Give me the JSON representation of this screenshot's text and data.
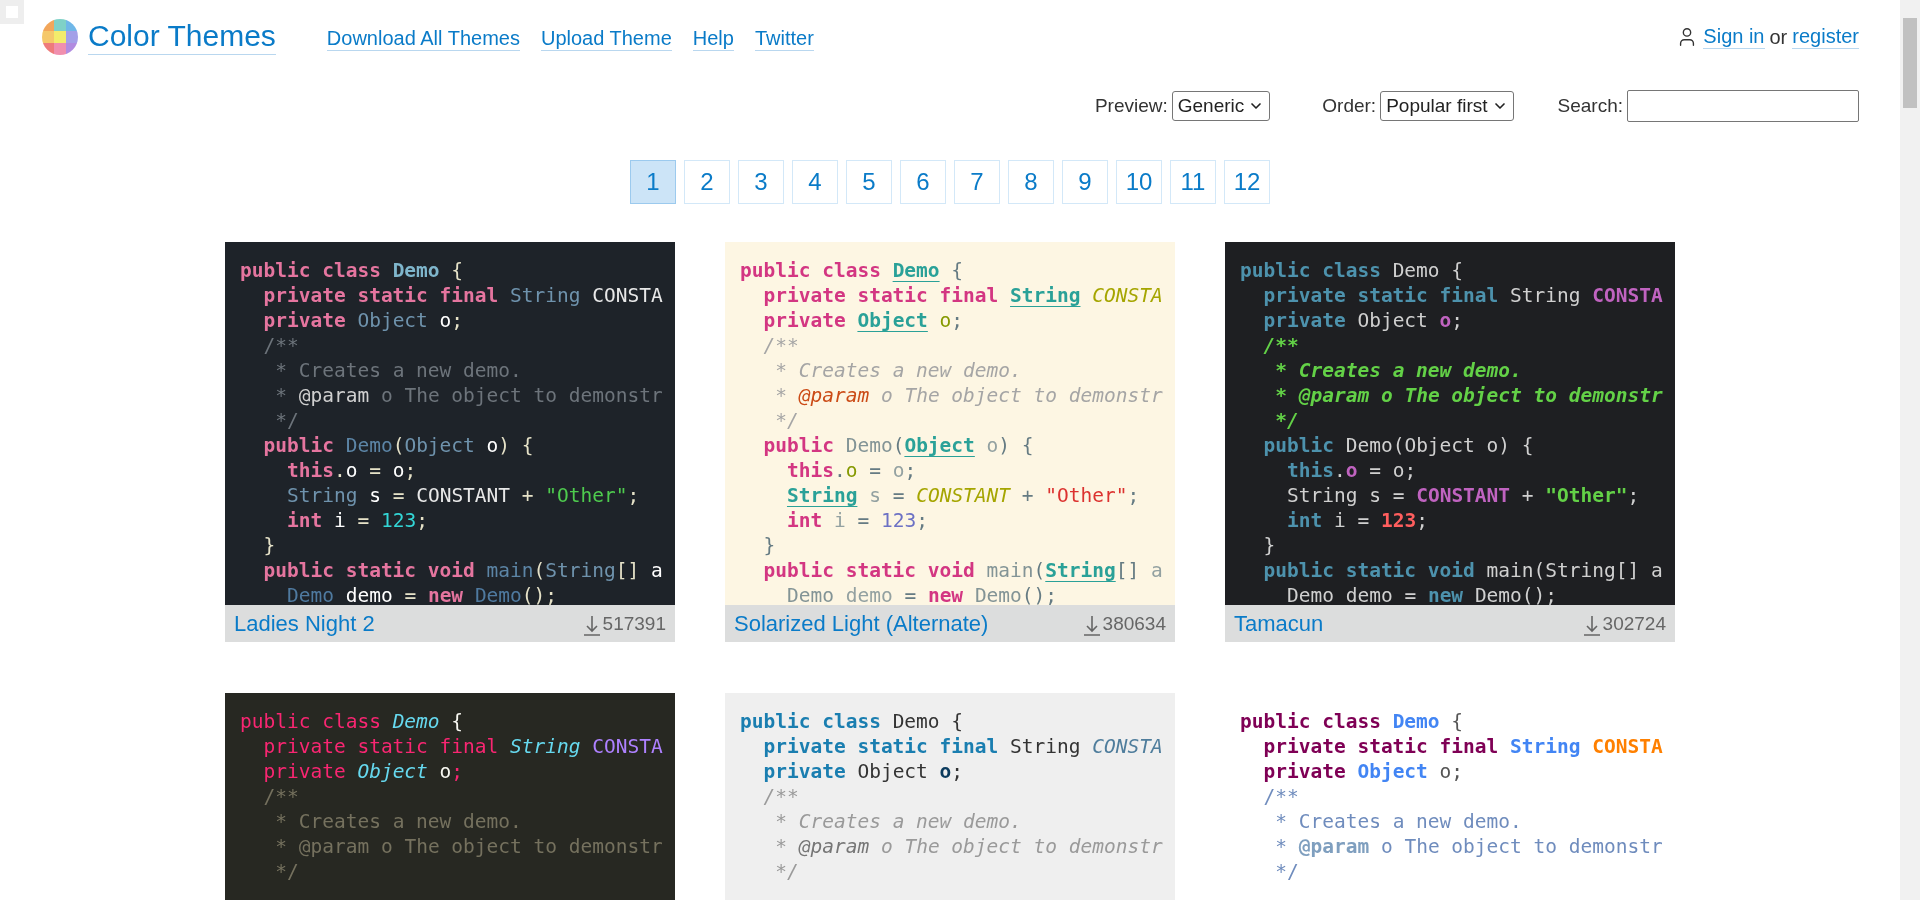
{
  "site": {
    "title": "Color Themes"
  },
  "nav": [
    "Download All Themes",
    "Upload Theme",
    "Help",
    "Twitter"
  ],
  "account": {
    "sign_in": "Sign in",
    "or": "or",
    "register": "register"
  },
  "controls": {
    "preview_label": "Preview:",
    "preview_value": "Generic",
    "order_label": "Order:",
    "order_value": "Popular first",
    "search_label": "Search:"
  },
  "pages": [
    {
      "label": "1",
      "selected": true
    },
    {
      "label": "2",
      "selected": false
    },
    {
      "label": "3",
      "selected": false
    },
    {
      "label": "4",
      "selected": false
    },
    {
      "label": "5",
      "selected": false
    },
    {
      "label": "6",
      "selected": false
    },
    {
      "label": "7",
      "selected": false
    },
    {
      "label": "8",
      "selected": false
    },
    {
      "label": "9",
      "selected": false
    },
    {
      "label": "10",
      "selected": false
    },
    {
      "label": "11",
      "selected": false
    },
    {
      "label": "12",
      "selected": false
    }
  ],
  "themes": [
    {
      "name": "Ladies Night 2",
      "downloads": "517391",
      "lines": [
        {
          "tokens": [
            {
              "kind": "kw",
              "text": "public class "
            },
            {
              "kind": "cls",
              "text": "Demo"
            },
            {
              "kind": "plain",
              "text": " {"
            }
          ]
        },
        {
          "tokens": [
            {
              "kind": "kw",
              "text": "  private static final "
            },
            {
              "kind": "type",
              "text": "String"
            },
            {
              "kind": "const",
              "text": " CONSTA"
            }
          ]
        },
        {
          "tokens": [
            {
              "kind": "kw",
              "text": "  private "
            },
            {
              "kind": "type",
              "text": "Object"
            },
            {
              "kind": "field",
              "text": " o"
            },
            {
              "kind": "plain",
              "text": ";"
            }
          ]
        },
        {
          "tokens": [
            {
              "kind": "comment",
              "text": "  /**"
            }
          ]
        },
        {
          "tokens": [
            {
              "kind": "comment",
              "text": "   * Creates a new demo."
            }
          ]
        },
        {
          "tokens": [
            {
              "kind": "comment",
              "text": "   * "
            },
            {
              "kind": "doctag",
              "text": "@param"
            },
            {
              "kind": "comment",
              "text": " o The object to demonstr"
            }
          ]
        },
        {
          "tokens": [
            {
              "kind": "comment",
              "text": "   */"
            }
          ]
        },
        {
          "tokens": [
            {
              "kind": "kw",
              "text": "  public "
            },
            {
              "kind": "fn",
              "text": "Demo"
            },
            {
              "kind": "plain",
              "text": "("
            },
            {
              "kind": "type",
              "text": "Object"
            },
            {
              "kind": "var",
              "text": " o"
            },
            {
              "kind": "plain",
              "text": ") {"
            }
          ]
        },
        {
          "tokens": [
            {
              "kind": "kw",
              "text": "    this"
            },
            {
              "kind": "plain",
              "text": "."
            },
            {
              "kind": "field",
              "text": "o"
            },
            {
              "kind": "plain",
              "text": " = "
            },
            {
              "kind": "var",
              "text": "o"
            },
            {
              "kind": "plain",
              "text": ";"
            }
          ]
        },
        {
          "tokens": [
            {
              "kind": "type",
              "text": "    String"
            },
            {
              "kind": "var",
              "text": " s"
            },
            {
              "kind": "plain",
              "text": " = "
            },
            {
              "kind": "const",
              "text": "CONSTANT"
            },
            {
              "kind": "plain",
              "text": " + "
            },
            {
              "kind": "str",
              "text": "\"Other\""
            },
            {
              "kind": "plain",
              "text": ";"
            }
          ]
        },
        {
          "tokens": [
            {
              "kind": "kw",
              "text": "    int"
            },
            {
              "kind": "var",
              "text": " i"
            },
            {
              "kind": "plain",
              "text": " = "
            },
            {
              "kind": "num",
              "text": "123"
            },
            {
              "kind": "plain",
              "text": ";"
            }
          ]
        },
        {
          "tokens": [
            {
              "kind": "plain",
              "text": "  }"
            }
          ]
        },
        {
          "tokens": [
            {
              "kind": "kw",
              "text": "  public static void "
            },
            {
              "kind": "fn",
              "text": "main"
            },
            {
              "kind": "plain",
              "text": "("
            },
            {
              "kind": "type",
              "text": "String"
            },
            {
              "kind": "plain",
              "text": "[] "
            },
            {
              "kind": "var",
              "text": "a"
            }
          ]
        },
        {
          "tokens": [
            {
              "kind": "ref",
              "text": "    Demo"
            },
            {
              "kind": "var",
              "text": " demo"
            },
            {
              "kind": "plain",
              "text": " = "
            },
            {
              "kind": "kw",
              "text": "new"
            },
            {
              "kind": "ref",
              "text": " Demo"
            },
            {
              "kind": "plain",
              "text": "();"
            }
          ]
        }
      ]
    },
    {
      "name": "Solarized Light (Alternate)",
      "downloads": "380634",
      "lines": [
        {
          "tokens": [
            {
              "kind": "kw",
              "text": "public class "
            },
            {
              "kind": "cls",
              "text": "Demo"
            },
            {
              "kind": "plain",
              "text": " {"
            }
          ]
        },
        {
          "tokens": [
            {
              "kind": "kw",
              "text": "  private static final "
            },
            {
              "kind": "type",
              "text": "String"
            },
            {
              "kind": "const",
              "text": " CONSTA"
            }
          ]
        },
        {
          "tokens": [
            {
              "kind": "kw",
              "text": "  private "
            },
            {
              "kind": "type",
              "text": "Object"
            },
            {
              "kind": "field",
              "text": " o"
            },
            {
              "kind": "plain",
              "text": ";"
            }
          ]
        },
        {
          "tokens": [
            {
              "kind": "comment",
              "text": "  /**"
            }
          ]
        },
        {
          "tokens": [
            {
              "kind": "comment",
              "text": "   * Creates a new demo."
            }
          ]
        },
        {
          "tokens": [
            {
              "kind": "comment",
              "text": "   * "
            },
            {
              "kind": "doctag",
              "text": "@param"
            },
            {
              "kind": "comment",
              "text": " o The object to demonstr"
            }
          ]
        },
        {
          "tokens": [
            {
              "kind": "comment",
              "text": "   */"
            }
          ]
        },
        {
          "tokens": [
            {
              "kind": "kw",
              "text": "  public "
            },
            {
              "kind": "fn",
              "text": "Demo"
            },
            {
              "kind": "plain",
              "text": "("
            },
            {
              "kind": "type",
              "text": "Object"
            },
            {
              "kind": "var",
              "text": " o"
            },
            {
              "kind": "plain",
              "text": ") {"
            }
          ]
        },
        {
          "tokens": [
            {
              "kind": "kw",
              "text": "    this"
            },
            {
              "kind": "plain",
              "text": "."
            },
            {
              "kind": "field",
              "text": "o"
            },
            {
              "kind": "plain",
              "text": " = "
            },
            {
              "kind": "var",
              "text": "o"
            },
            {
              "kind": "plain",
              "text": ";"
            }
          ]
        },
        {
          "tokens": [
            {
              "kind": "type",
              "text": "    String"
            },
            {
              "kind": "var",
              "text": " s"
            },
            {
              "kind": "plain",
              "text": " = "
            },
            {
              "kind": "const",
              "text": "CONSTANT"
            },
            {
              "kind": "plain",
              "text": " + "
            },
            {
              "kind": "str",
              "text": "\"Other\""
            },
            {
              "kind": "plain",
              "text": ";"
            }
          ]
        },
        {
          "tokens": [
            {
              "kind": "kw",
              "text": "    int"
            },
            {
              "kind": "var",
              "text": " i"
            },
            {
              "kind": "plain",
              "text": " = "
            },
            {
              "kind": "num",
              "text": "123"
            },
            {
              "kind": "plain",
              "text": ";"
            }
          ]
        },
        {
          "tokens": [
            {
              "kind": "plain",
              "text": "  }"
            }
          ]
        },
        {
          "tokens": [
            {
              "kind": "kw",
              "text": "  public static void "
            },
            {
              "kind": "fn",
              "text": "main"
            },
            {
              "kind": "plain",
              "text": "("
            },
            {
              "kind": "type",
              "text": "String"
            },
            {
              "kind": "plain",
              "text": "[] "
            },
            {
              "kind": "var",
              "text": "a"
            }
          ]
        },
        {
          "tokens": [
            {
              "kind": "ref",
              "text": "    Demo"
            },
            {
              "kind": "var",
              "text": " demo"
            },
            {
              "kind": "plain",
              "text": " = "
            },
            {
              "kind": "kw",
              "text": "new"
            },
            {
              "kind": "ref",
              "text": " Demo"
            },
            {
              "kind": "plain",
              "text": "();"
            }
          ]
        }
      ]
    },
    {
      "name": "Tamacun",
      "downloads": "302724",
      "lines": [
        {
          "tokens": [
            {
              "kind": "kw",
              "text": "public class "
            },
            {
              "kind": "cls",
              "text": "Demo"
            },
            {
              "kind": "plain",
              "text": " {"
            }
          ]
        },
        {
          "tokens": [
            {
              "kind": "kw",
              "text": "  private static final "
            },
            {
              "kind": "type",
              "text": "String"
            },
            {
              "kind": "const",
              "text": " CONSTA"
            }
          ]
        },
        {
          "tokens": [
            {
              "kind": "kw",
              "text": "  private "
            },
            {
              "kind": "type",
              "text": "Object"
            },
            {
              "kind": "field",
              "text": " o"
            },
            {
              "kind": "plain",
              "text": ";"
            }
          ]
        },
        {
          "tokens": [
            {
              "kind": "comment",
              "text": "  /**"
            }
          ]
        },
        {
          "tokens": [
            {
              "kind": "comment",
              "text": "   * Creates a new demo."
            }
          ]
        },
        {
          "tokens": [
            {
              "kind": "comment",
              "text": "   * "
            },
            {
              "kind": "doctag",
              "text": "@param"
            },
            {
              "kind": "comment",
              "text": " o The object to demonstr"
            }
          ]
        },
        {
          "tokens": [
            {
              "kind": "comment",
              "text": "   */"
            }
          ]
        },
        {
          "tokens": [
            {
              "kind": "kw",
              "text": "  public "
            },
            {
              "kind": "fn",
              "text": "Demo"
            },
            {
              "kind": "plain",
              "text": "("
            },
            {
              "kind": "type",
              "text": "Object"
            },
            {
              "kind": "var",
              "text": " o"
            },
            {
              "kind": "plain",
              "text": ") {"
            }
          ]
        },
        {
          "tokens": [
            {
              "kind": "kw",
              "text": "    this"
            },
            {
              "kind": "plain",
              "text": "."
            },
            {
              "kind": "field",
              "text": "o"
            },
            {
              "kind": "plain",
              "text": " = "
            },
            {
              "kind": "var",
              "text": "o"
            },
            {
              "kind": "plain",
              "text": ";"
            }
          ]
        },
        {
          "tokens": [
            {
              "kind": "type",
              "text": "    String"
            },
            {
              "kind": "var",
              "text": " s"
            },
            {
              "kind": "plain",
              "text": " = "
            },
            {
              "kind": "const",
              "text": "CONSTANT"
            },
            {
              "kind": "plain",
              "text": " + "
            },
            {
              "kind": "str",
              "text": "\"Other\""
            },
            {
              "kind": "plain",
              "text": ";"
            }
          ]
        },
        {
          "tokens": [
            {
              "kind": "kw",
              "text": "    int"
            },
            {
              "kind": "var",
              "text": " i"
            },
            {
              "kind": "plain",
              "text": " = "
            },
            {
              "kind": "num",
              "text": "123"
            },
            {
              "kind": "plain",
              "text": ";"
            }
          ]
        },
        {
          "tokens": [
            {
              "kind": "plain",
              "text": "  }"
            }
          ]
        },
        {
          "tokens": [
            {
              "kind": "kw",
              "text": "  public static void "
            },
            {
              "kind": "fn",
              "text": "main"
            },
            {
              "kind": "plain",
              "text": "("
            },
            {
              "kind": "type",
              "text": "String"
            },
            {
              "kind": "plain",
              "text": "[] "
            },
            {
              "kind": "var",
              "text": "a"
            }
          ]
        },
        {
          "tokens": [
            {
              "kind": "ref",
              "text": "    Demo"
            },
            {
              "kind": "var",
              "text": " demo"
            },
            {
              "kind": "plain",
              "text": " = "
            },
            {
              "kind": "kw",
              "text": "new"
            },
            {
              "kind": "ref",
              "text": " Demo"
            },
            {
              "kind": "plain",
              "text": "();"
            }
          ]
        }
      ]
    },
    {
      "lines": [
        {
          "tokens": [
            {
              "kind": "kw",
              "text": "public class "
            },
            {
              "kind": "cls",
              "text": "Demo"
            },
            {
              "kind": "plain",
              "text": " {"
            }
          ]
        },
        {
          "tokens": [
            {
              "kind": "kw",
              "text": "  private static final "
            },
            {
              "kind": "type",
              "text": "String"
            },
            {
              "kind": "const",
              "text": " CONSTA"
            }
          ]
        },
        {
          "tokens": [
            {
              "kind": "kw",
              "text": "  private "
            },
            {
              "kind": "type",
              "text": "Object"
            },
            {
              "kind": "field",
              "text": " o"
            },
            {
              "kind": "kw",
              "text": ";"
            }
          ]
        },
        {
          "tokens": [
            {
              "kind": "comment",
              "text": "  /**"
            }
          ]
        },
        {
          "tokens": [
            {
              "kind": "comment",
              "text": "   * Creates a new demo."
            }
          ]
        },
        {
          "tokens": [
            {
              "kind": "comment",
              "text": "   * "
            },
            {
              "kind": "doctag",
              "text": "@param"
            },
            {
              "kind": "comment",
              "text": " o The object to demonstr"
            }
          ]
        },
        {
          "tokens": [
            {
              "kind": "comment",
              "text": "   */"
            }
          ]
        }
      ]
    },
    {
      "lines": [
        {
          "tokens": [
            {
              "kind": "kw",
              "text": "public class "
            },
            {
              "kind": "cls",
              "text": "Demo"
            },
            {
              "kind": "plain",
              "text": " {"
            }
          ]
        },
        {
          "tokens": [
            {
              "kind": "kw",
              "text": "  private static final "
            },
            {
              "kind": "type",
              "text": "String"
            },
            {
              "kind": "const",
              "text": " CONSTA"
            }
          ]
        },
        {
          "tokens": [
            {
              "kind": "kw",
              "text": "  private "
            },
            {
              "kind": "type",
              "text": "Object"
            },
            {
              "kind": "field",
              "text": " o"
            },
            {
              "kind": "plain",
              "text": ";"
            }
          ]
        },
        {
          "tokens": [
            {
              "kind": "comment",
              "text": "  /**"
            }
          ]
        },
        {
          "tokens": [
            {
              "kind": "comment",
              "text": "   * Creates a new demo."
            }
          ]
        },
        {
          "tokens": [
            {
              "kind": "comment",
              "text": "   * "
            },
            {
              "kind": "doctag",
              "text": "@param"
            },
            {
              "kind": "comment",
              "text": " o The object to demonstr"
            }
          ]
        },
        {
          "tokens": [
            {
              "kind": "comment",
              "text": "   */"
            }
          ]
        }
      ]
    },
    {
      "lines": [
        {
          "tokens": [
            {
              "kind": "kw",
              "text": "public class "
            },
            {
              "kind": "cls",
              "text": "Demo"
            },
            {
              "kind": "plain",
              "text": " {"
            }
          ]
        },
        {
          "tokens": [
            {
              "kind": "kw",
              "text": "  private static final "
            },
            {
              "kind": "type",
              "text": "String"
            },
            {
              "kind": "const",
              "text": " CONSTA"
            }
          ]
        },
        {
          "tokens": [
            {
              "kind": "kw",
              "text": "  private "
            },
            {
              "kind": "type",
              "text": "Object"
            },
            {
              "kind": "field",
              "text": " o"
            },
            {
              "kind": "plain",
              "text": ";"
            }
          ]
        },
        {
          "tokens": [
            {
              "kind": "comment",
              "text": "  /**"
            }
          ]
        },
        {
          "tokens": [
            {
              "kind": "comment",
              "text": "   * Creates a new demo."
            }
          ]
        },
        {
          "tokens": [
            {
              "kind": "comment",
              "text": "   * "
            },
            {
              "kind": "doctag",
              "text": "@param"
            },
            {
              "kind": "comment",
              "text": " o The object to demonstr"
            }
          ]
        },
        {
          "tokens": [
            {
              "kind": "comment",
              "text": "   */"
            }
          ]
        }
      ]
    }
  ]
}
